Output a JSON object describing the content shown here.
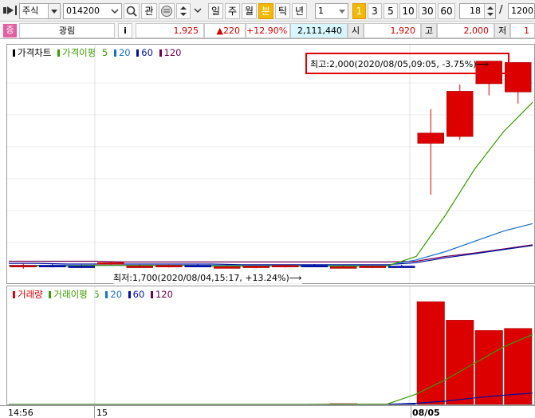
{
  "toolbar": {
    "market_select": "주식",
    "code_value": "014200",
    "watch_label": "관",
    "period_buttons": [
      "일",
      "주",
      "월",
      "분",
      "틱",
      "년"
    ],
    "selected_period": "분",
    "interval_value": "1",
    "interval_buttons": [
      "1",
      "3",
      "5",
      "10",
      "30",
      "60"
    ],
    "selected_interval": "1",
    "count_value": "18",
    "slash": "/",
    "total_value": "1200"
  },
  "quote": {
    "badge": "증",
    "name": "광림",
    "info_label": "i",
    "price": "1,925",
    "change": "▲220",
    "change_pct": "+12.90%",
    "volume": "2,111,440",
    "open_label": "시",
    "open_value": "1,920",
    "high_label": "고",
    "high_value": "2,000",
    "low_label": "저",
    "low_value": "1"
  },
  "price_pane": {
    "legend_title": "가격차트",
    "legend_ma_label": "가격이평",
    "legend_ma_periods": [
      "5",
      "20",
      "60",
      "120"
    ],
    "high_annotation": "최고:2,000(2020/08/05,09:05, -3.75%)⟶",
    "low_annotation": "최저:1,700(2020/08/04,15:17, +13.24%)⟶"
  },
  "volume_pane": {
    "legend_title": "거래량",
    "legend_ma_label": "거래이평",
    "legend_ma_periods": [
      "5",
      "20",
      "60",
      "120"
    ]
  },
  "xaxis": {
    "labels": [
      "14:56",
      "15",
      "08/05"
    ]
  },
  "colors": {
    "up": "#dd0000",
    "down": "#0018c8",
    "ma5": "#3a9a00",
    "ma20": "#1a70c8",
    "ma60": "#0010a0",
    "ma120": "#700050",
    "highlight_box": "#e00000"
  },
  "chart_data": [
    {
      "type": "candlestick",
      "title": "가격차트",
      "candles": [
        {
          "o": 1700,
          "h": 1705,
          "l": 1697,
          "c": 1702
        },
        {
          "o": 1702,
          "h": 1704,
          "l": 1699,
          "c": 1701
        },
        {
          "o": 1701,
          "h": 1703,
          "l": 1698,
          "c": 1700
        },
        {
          "o": 1705,
          "h": 1707,
          "l": 1703,
          "c": 1706
        },
        {
          "o": 1700,
          "h": 1703,
          "l": 1699,
          "c": 1701
        },
        {
          "o": 1701,
          "h": 1703,
          "l": 1699,
          "c": 1702
        },
        {
          "o": 1702,
          "h": 1704,
          "l": 1700,
          "c": 1701
        },
        {
          "o": 1700,
          "h": 1702,
          "l": 1698,
          "c": 1700
        },
        {
          "o": 1700,
          "h": 1702,
          "l": 1698,
          "c": 1701
        },
        {
          "o": 1701,
          "h": 1703,
          "l": 1699,
          "c": 1702
        },
        {
          "o": 1702,
          "h": 1704,
          "l": 1700,
          "c": 1701
        },
        {
          "o": 1700,
          "h": 1702,
          "l": 1699,
          "c": 1700
        },
        {
          "o": 1700,
          "h": 1702,
          "l": 1698,
          "c": 1701
        },
        {
          "o": 1701,
          "h": 1703,
          "l": 1699,
          "c": 1700
        },
        {
          "o": 1880,
          "h": 1930,
          "l": 1805,
          "c": 1895
        },
        {
          "o": 1890,
          "h": 1966,
          "l": 1885,
          "c": 1956
        },
        {
          "o": 1967,
          "h": 2000,
          "l": 1950,
          "c": 2000
        },
        {
          "o": 1955,
          "h": 1998,
          "l": 1938,
          "c": 1998
        }
      ],
      "ma5": [
        1701,
        1701,
        1701,
        1702,
        1702,
        1702,
        1702,
        1701,
        1701,
        1701,
        1701,
        1701,
        1701,
        1701,
        1715,
        1775,
        1842,
        1897,
        1940
      ],
      "ma20": [
        1702,
        1702,
        1702,
        1702,
        1702,
        1702,
        1702,
        1702,
        1702,
        1702,
        1702,
        1702,
        1702,
        1702,
        1710,
        1722,
        1737,
        1752,
        1763
      ],
      "ma60": [
        1705,
        1705,
        1704,
        1704,
        1704,
        1704,
        1704,
        1704,
        1703,
        1703,
        1703,
        1703,
        1703,
        1703,
        1706,
        1713,
        1719,
        1725,
        1731
      ],
      "ma120": [
        1708,
        1708,
        1708,
        1708,
        1707,
        1707,
        1707,
        1707,
        1707,
        1707,
        1707,
        1707,
        1707,
        1707,
        1708,
        1715,
        1720,
        1726,
        1732
      ],
      "ylim": [
        1690,
        2010
      ]
    },
    {
      "type": "bar",
      "title": "거래량",
      "values": [
        0,
        0,
        0,
        0,
        0,
        0,
        0,
        0,
        0,
        0,
        0,
        4000,
        1500,
        3000,
        500000,
        410000,
        360000,
        370000
      ],
      "ma5": [
        0,
        0,
        0,
        0,
        0,
        0,
        0,
        0,
        0,
        0,
        0,
        800,
        1100,
        1700,
        50000,
        120000,
        200000,
        280000,
        340000
      ],
      "ma20": [
        0,
        0,
        0,
        0,
        0,
        0,
        0,
        0,
        0,
        0,
        0,
        200,
        300,
        400,
        6000,
        16000,
        32000,
        45000,
        55000
      ],
      "ylim": [
        0,
        520000
      ]
    }
  ]
}
